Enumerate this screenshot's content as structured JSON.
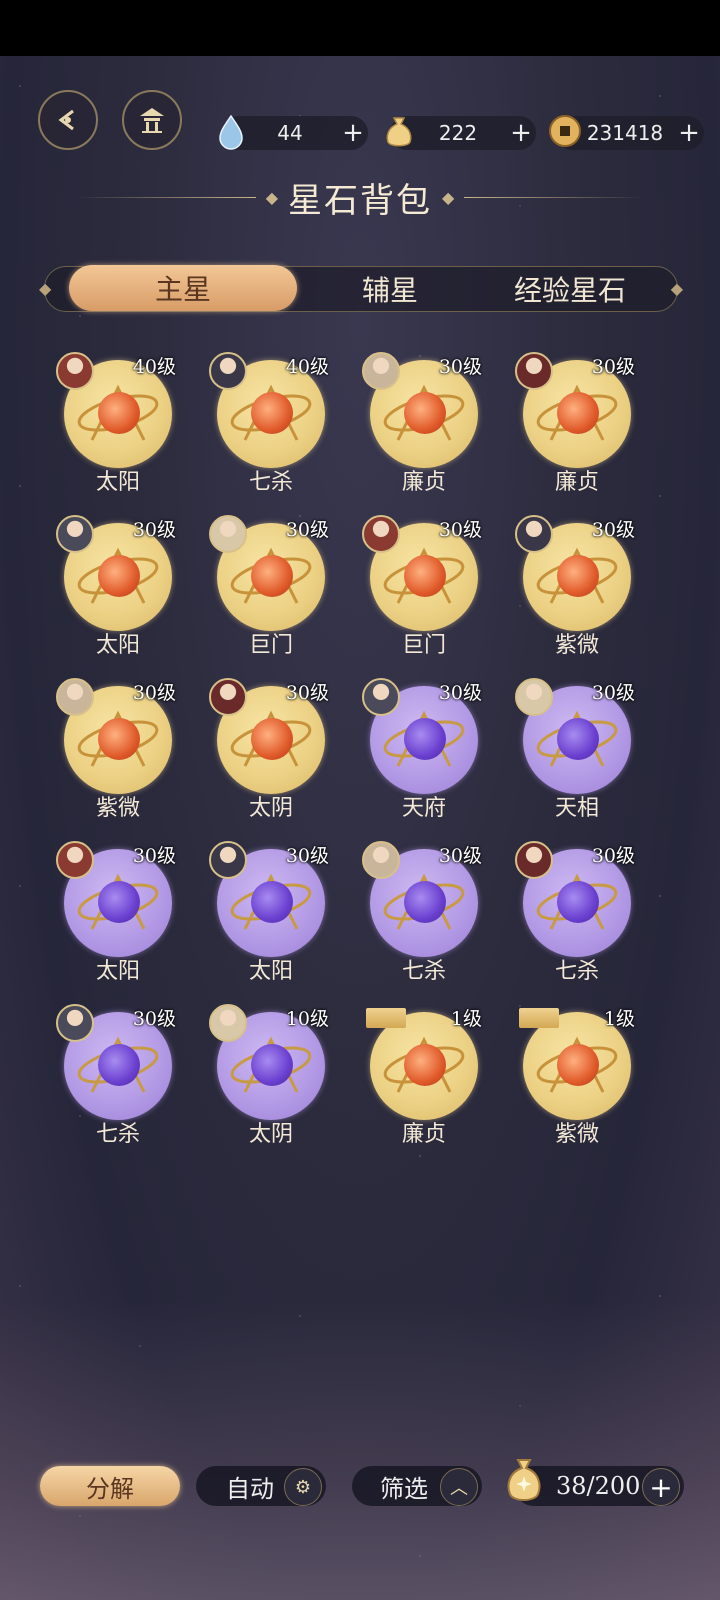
{
  "header": {
    "title": "星石背包",
    "currencies": [
      {
        "icon": "water-drop-icon",
        "value": "44",
        "plus": "+"
      },
      {
        "icon": "money-bag-icon",
        "value": "222",
        "plus": "+"
      },
      {
        "icon": "coin-icon",
        "value": "231418",
        "plus": "+"
      }
    ]
  },
  "tabs": [
    {
      "label": "主星",
      "active": true
    },
    {
      "label": "辅星",
      "active": false
    },
    {
      "label": "经验星石",
      "active": false
    }
  ],
  "stones": [
    {
      "name": "太阳",
      "level": "40级",
      "color": "gold"
    },
    {
      "name": "七杀",
      "level": "40级",
      "color": "gold"
    },
    {
      "name": "廉贞",
      "level": "30级",
      "color": "gold"
    },
    {
      "name": "廉贞",
      "level": "30级",
      "color": "gold"
    },
    {
      "name": "太阳",
      "level": "30级",
      "color": "gold"
    },
    {
      "name": "巨门",
      "level": "30级",
      "color": "gold"
    },
    {
      "name": "巨门",
      "level": "30级",
      "color": "gold"
    },
    {
      "name": "紫微",
      "level": "30级",
      "color": "gold"
    },
    {
      "name": "紫微",
      "level": "30级",
      "color": "gold"
    },
    {
      "name": "太阴",
      "level": "30级",
      "color": "gold"
    },
    {
      "name": "天府",
      "level": "30级",
      "color": "purple"
    },
    {
      "name": "天相",
      "level": "30级",
      "color": "purple"
    },
    {
      "name": "太阳",
      "level": "30级",
      "color": "purple"
    },
    {
      "name": "太阳",
      "level": "30级",
      "color": "purple"
    },
    {
      "name": "七杀",
      "level": "30级",
      "color": "purple"
    },
    {
      "name": "七杀",
      "level": "30级",
      "color": "purple"
    },
    {
      "name": "七杀",
      "level": "30级",
      "color": "purple"
    },
    {
      "name": "太阴",
      "level": "10级",
      "color": "purple"
    },
    {
      "name": "廉贞",
      "level": "1级",
      "color": "gold",
      "new_tag": true
    },
    {
      "name": "紫微",
      "level": "1级",
      "color": "gold",
      "new_tag": true
    }
  ],
  "bottom": {
    "decompose_label": "分解",
    "auto_label": "自动",
    "filter_label": "筛选",
    "capacity": "38/200",
    "capacity_plus": "+"
  },
  "colors": {
    "gold_stone": "#ecd185",
    "purple_stone": "#b49be6",
    "accent": "#d9a66c"
  }
}
